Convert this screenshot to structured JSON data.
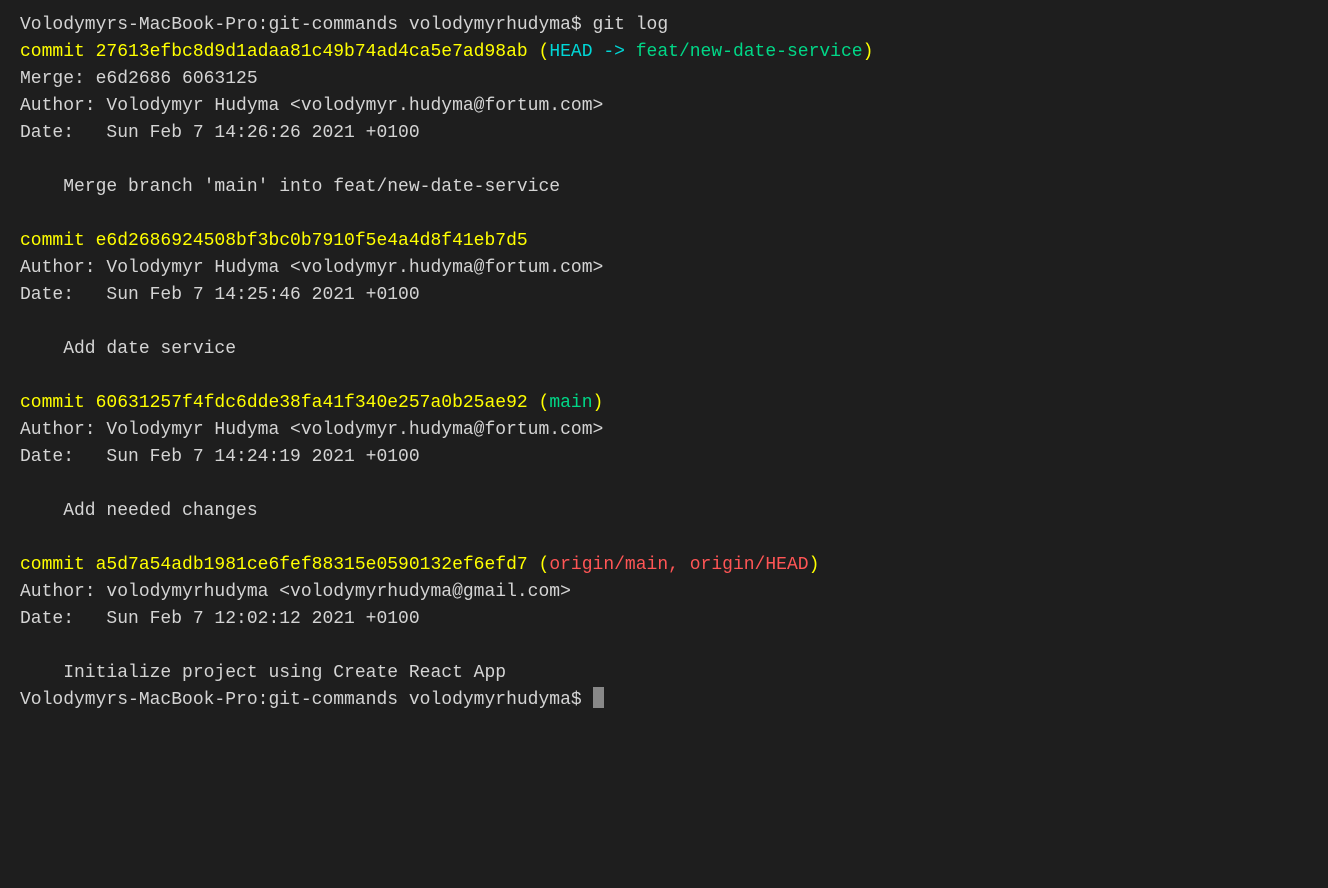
{
  "prompt": {
    "line1": "Volodymyrs-MacBook-Pro:git-commands volodymyrhudyma$",
    "line2": "Volodymyrs-MacBook-Pro:git-commands volodymyrhudyma$"
  },
  "command": "git log",
  "commits": [
    {
      "hashLine": "commit 27613efbc8d9d1adaa81c49b74ad4ca5e7ad98ab",
      "refs": {
        "head": "HEAD -> ",
        "branch": "feat/new-date-service"
      },
      "merge": "Merge: e6d2686 6063125",
      "author": "Author: Volodymyr Hudyma <volodymyr.hudyma@fortum.com>",
      "date": "Date:   Sun Feb 7 14:26:26 2021 +0100",
      "message": "    Merge branch 'main' into feat/new-date-service"
    },
    {
      "hashLine": "commit e6d2686924508bf3bc0b7910f5e4a4d8f41eb7d5",
      "author": "Author: Volodymyr Hudyma <volodymyr.hudyma@fortum.com>",
      "date": "Date:   Sun Feb 7 14:25:46 2021 +0100",
      "message": "    Add date service"
    },
    {
      "hashLine": "commit 60631257f4fdc6dde38fa41f340e257a0b25ae92",
      "refs": {
        "branch": "main"
      },
      "author": "Author: Volodymyr Hudyma <volodymyr.hudyma@fortum.com>",
      "date": "Date:   Sun Feb 7 14:24:19 2021 +0100",
      "message": "    Add needed changes"
    },
    {
      "hashLine": "commit a5d7a54adb1981ce6fef88315e0590132ef6efd7",
      "refs": {
        "remote": "origin/main, origin/HEAD"
      },
      "author": "Author: volodymyrhudyma <volodymyrhudyma@gmail.com>",
      "date": "Date:   Sun Feb 7 12:02:12 2021 +0100",
      "message": "    Initialize project using Create React App"
    }
  ]
}
